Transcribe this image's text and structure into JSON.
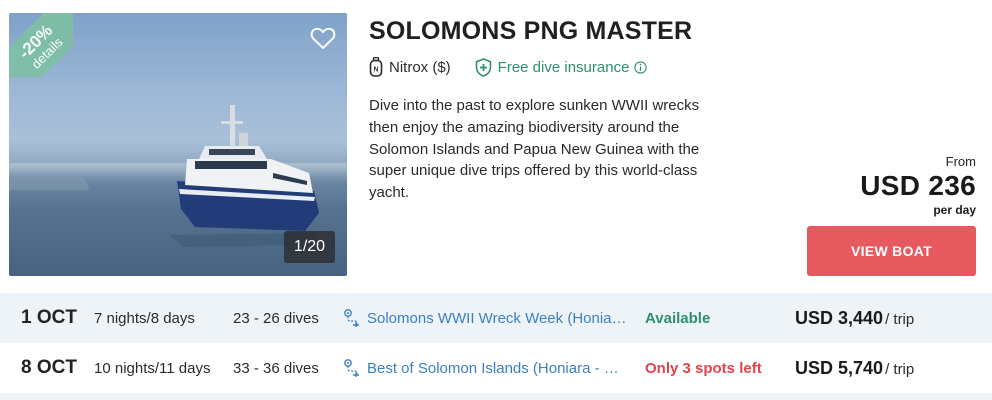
{
  "listing": {
    "discount_badge": {
      "percent": "-20%",
      "label": "details"
    },
    "photo_counter": "1/20",
    "title": "SOLOMONS PNG MASTER",
    "features": {
      "nitrox": "Nitrox ($)",
      "insurance": "Free dive insurance"
    },
    "description": "Dive into the past to explore sunken WWII wrecks then enjoy the amazing biodiversity around the Solomon Islands and Papua New Guinea with the super unique dive trips offered by this world-class yacht.",
    "price": {
      "from_label": "From",
      "amount": "USD 236",
      "per_label": "per day"
    },
    "view_button": "VIEW BOAT"
  },
  "trips": [
    {
      "date": "1 OCT",
      "nights": "7 nights/8 days",
      "dives": "23 - 26 dives",
      "route": "Solomons WWII Wreck Week (Honiara - Honiara)",
      "status": "Available",
      "status_color": "#2f8f6f",
      "price": "USD 3,440",
      "price_unit": "/ trip"
    },
    {
      "date": "8 OCT",
      "nights": "10 nights/11 days",
      "dives": "33 - 36 dives",
      "route": "Best of Solomon Islands (Honiara - Honiara)",
      "status": "Only 3 spots left",
      "status_color": "#e0454c",
      "price": "USD 5,740",
      "price_unit": "/ trip"
    }
  ],
  "colors": {
    "accent_green": "#2f8f6f",
    "link_blue": "#3c80c0",
    "cta_red": "#e65a5f",
    "row_tint": "#eef3f8",
    "badge_green": "#7fbfa6"
  },
  "icons": {
    "favorite": "heart-outline-icon",
    "nitrox": "tank-icon",
    "insurance": "shield-plus-icon",
    "info": "info-circle-icon",
    "route": "route-pin-icon"
  }
}
